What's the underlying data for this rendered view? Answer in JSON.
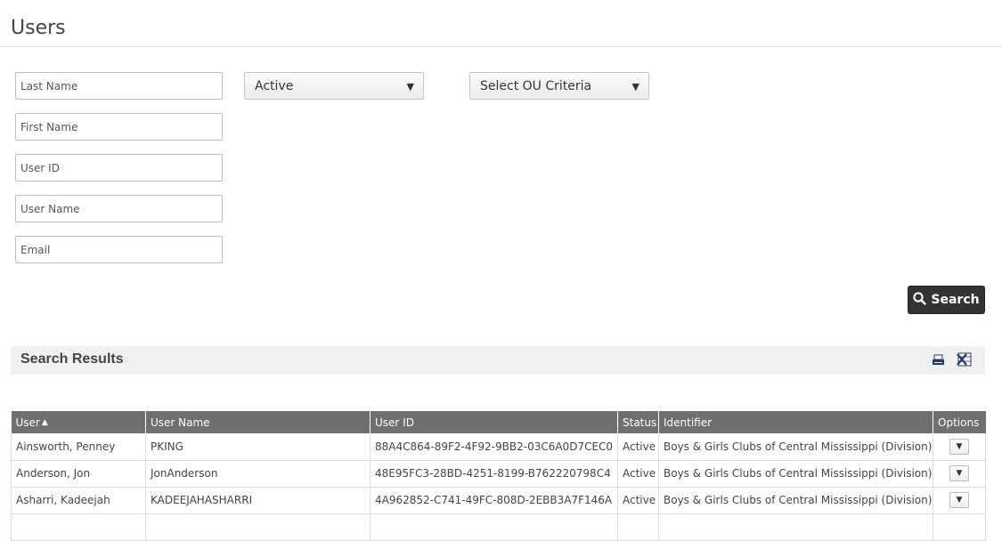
{
  "page": {
    "title": "Users"
  },
  "filters": {
    "last_name_placeholder": "Last Name",
    "first_name_placeholder": "First Name",
    "user_id_placeholder": "User ID",
    "user_name_placeholder": "User Name",
    "email_placeholder": "Email",
    "status_selected": "Active",
    "ou_selected": "Select OU Criteria",
    "search_label": "Search"
  },
  "results": {
    "title": "Search Results",
    "columns": [
      "User",
      "User Name",
      "User ID",
      "Status",
      "Identifier",
      "Options"
    ],
    "rows": [
      {
        "user": "Ainsworth, Penney",
        "user_name": "PKING",
        "user_id": "88A4C864-89F2-4F92-9BB2-03C6A0D7CEC0",
        "status": "Active",
        "identifier": "Boys & Girls Clubs of Central Mississippi (Division)"
      },
      {
        "user": "Anderson, Jon",
        "user_name": "JonAnderson",
        "user_id": "48E95FC3-28BD-4251-8199-B762220798C4",
        "status": "Active",
        "identifier": "Boys & Girls Clubs of Central Mississippi (Division)"
      },
      {
        "user": "Asharri, Kadeejah",
        "user_name": "KADEEJAHASHARRI",
        "user_id": "4A962852-C741-49FC-808D-2EBB3A7F146A",
        "status": "Active",
        "identifier": "Boys & Girls Clubs of Central Mississippi (Division)"
      },
      {
        "user": "",
        "user_name": "",
        "user_id": "",
        "status": "",
        "identifier": ""
      }
    ]
  },
  "icons": {
    "status_caret": "caret-down-icon",
    "ou_caret": "caret-down-icon",
    "search": "search-icon",
    "print": "print-icon",
    "excel": "excel-icon",
    "sort": "sort-icon",
    "options": "caret-down-icon"
  },
  "colors": {
    "header_bg": "#6f6f6f",
    "search_button_bg": "#333333",
    "results_bar_bg": "#f0f0f0",
    "excel_icon": "#1f3a6b"
  }
}
